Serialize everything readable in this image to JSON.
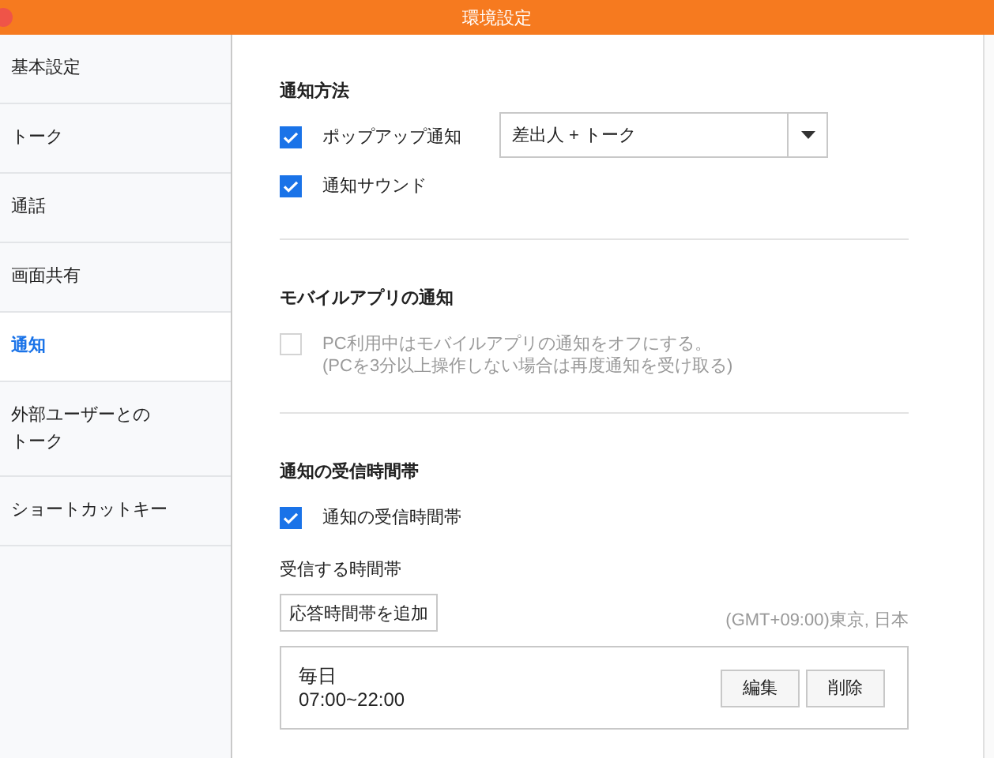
{
  "window": {
    "title": "環境設定"
  },
  "sidebar": {
    "items": [
      {
        "label": "基本設定",
        "selected": false
      },
      {
        "label": "トーク",
        "selected": false
      },
      {
        "label": "通話",
        "selected": false
      },
      {
        "label": "画面共有",
        "selected": false
      },
      {
        "label": "通知",
        "selected": true
      },
      {
        "label": "外部ユーザーとのトーク",
        "selected": false
      },
      {
        "label": "ショートカットキー",
        "selected": false
      }
    ]
  },
  "sections": [
    {
      "title": "通知方法",
      "options": [
        {
          "label": "ポップアップ通知",
          "checked": true,
          "disabled": false,
          "select": {
            "value": "差出人 + トーク"
          }
        },
        {
          "label": "通知サウンド",
          "checked": true,
          "disabled": false
        }
      ]
    },
    {
      "title": "モバイルアプリの通知",
      "options": [
        {
          "label": "PC利用中はモバイルアプリの通知をオフにする。\n(PCを3分以上操作しない場合は再度通知を受け取る)",
          "checked": false,
          "disabled": true
        }
      ]
    },
    {
      "title": "通知の受信時間帯",
      "options": [
        {
          "label": "通知の受信時間帯",
          "checked": true,
          "disabled": false
        }
      ],
      "schedule": {
        "label": "受信する時間帯",
        "add_button": "応答時間帯を追加",
        "timezone": "(GMT+09:00)東京, 日本",
        "entries": [
          {
            "days": "毎日",
            "time": "07:00~22:00",
            "buttons": [
              "編集",
              "削除"
            ]
          }
        ]
      }
    }
  ]
}
